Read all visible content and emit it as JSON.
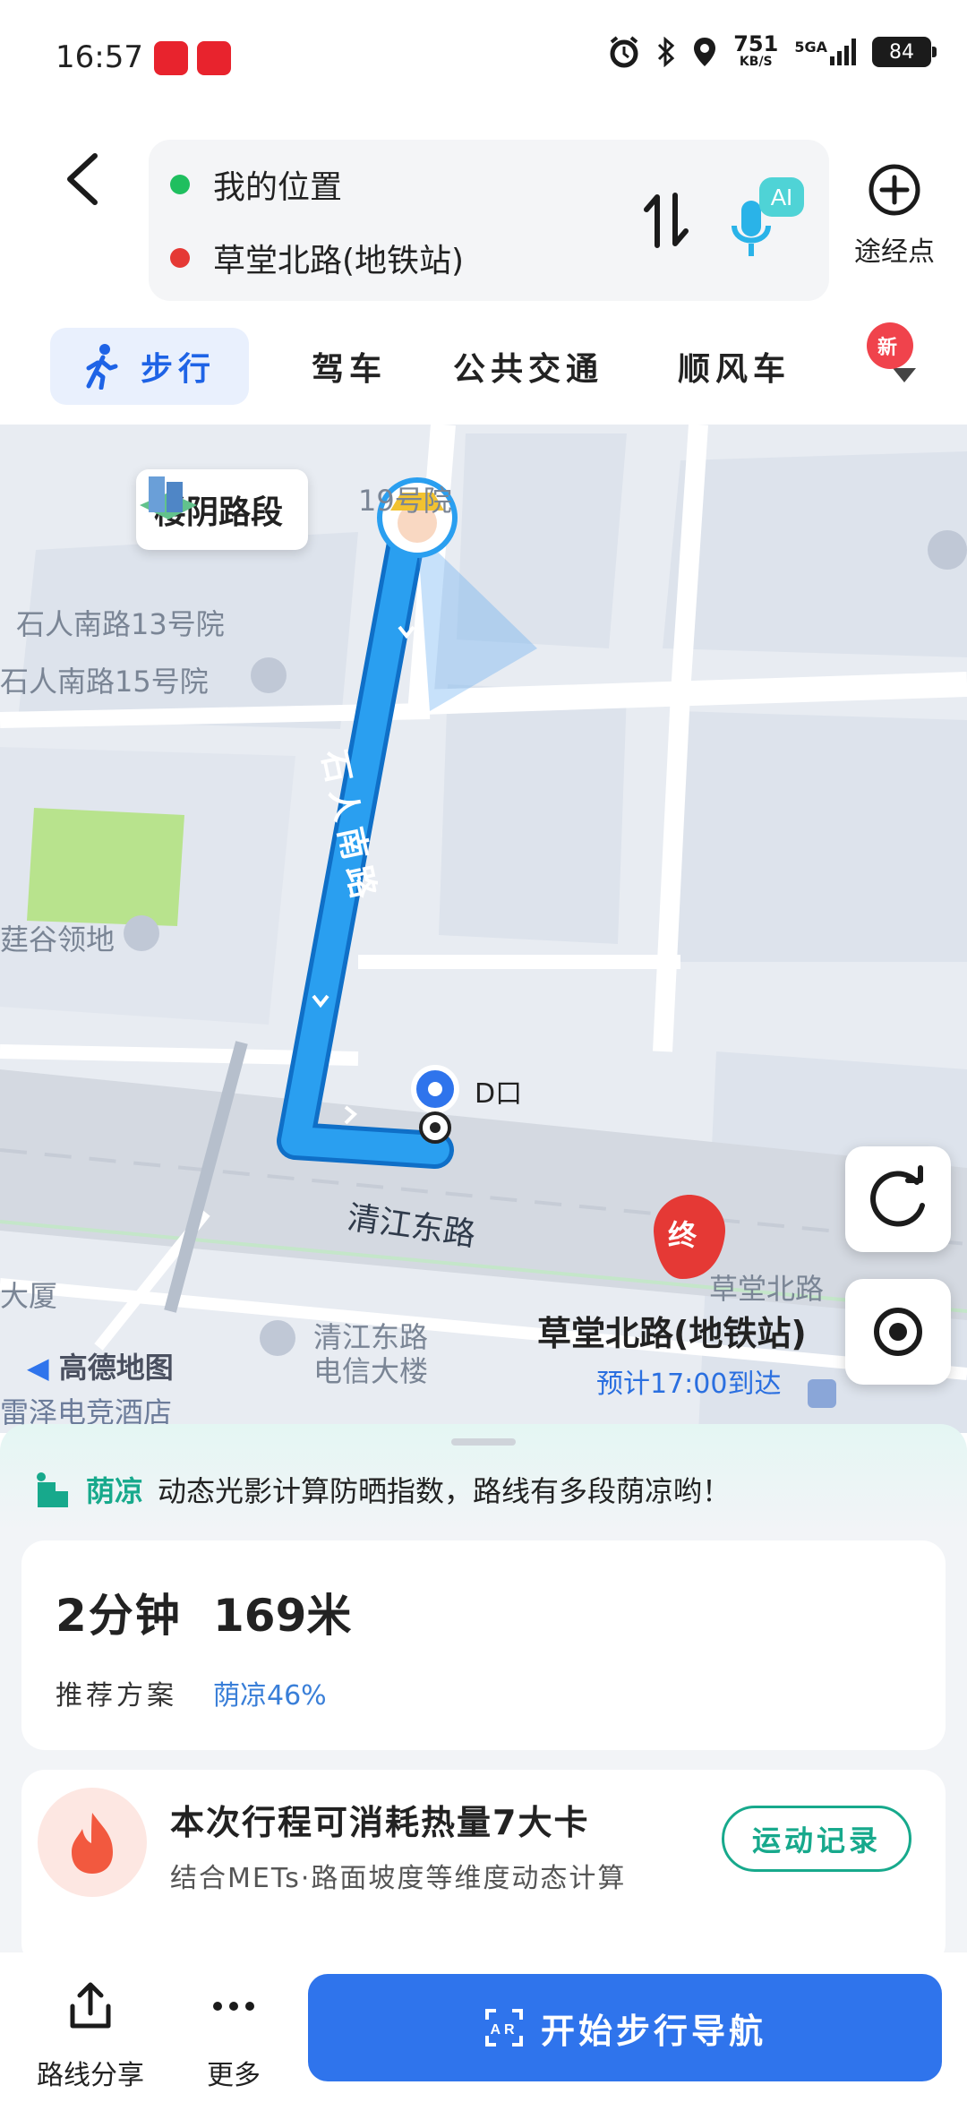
{
  "status_bar": {
    "time": "16:57",
    "speed_value": "751",
    "speed_unit": "KB/S",
    "network": "5GA",
    "battery": "84"
  },
  "route": {
    "origin": "我的位置",
    "destination": "草堂北路(地铁站)",
    "origin_color": "#1fbf5f",
    "destination_color": "#e53935",
    "ai_label": "AI",
    "waypoint_label": "途经点"
  },
  "tabs": [
    {
      "label": "步行",
      "active": true
    },
    {
      "label": "驾车",
      "active": false
    },
    {
      "label": "公共交通",
      "active": false
    },
    {
      "label": "顺风车",
      "active": false
    }
  ],
  "new_badge": "新",
  "map": {
    "segment_chip": "楼阴路段",
    "labels": {
      "yard19": "19号院",
      "shiren13": "石人南路13号院",
      "shiren15": "石人南路15号院",
      "lingdi": "莛谷领地",
      "street_vertical": "石人南路",
      "exit_d": "D口",
      "qingjiang": "清江东路",
      "dasha": "大厦",
      "telecom": "清江东路\n电信大楼",
      "hotel": "雷泽电竞酒店",
      "caotang_small": "草堂北路"
    },
    "brand": "高德地图",
    "dest_marker": "终",
    "dest_title": "草堂北路(地铁站)",
    "eta": "预计17:00到达",
    "route_color": "#2a9ff0"
  },
  "sheet": {
    "shade_tag": "荫凉",
    "shade_text": "动态光影计算防晒指数，路线有多段荫凉哟！",
    "route_time": "2分钟",
    "route_distance": "169米",
    "route_recommend": "推荐方案",
    "route_shade": "荫凉46%",
    "calorie_title": "本次行程可消耗热量7大卡",
    "calorie_sub": "结合METs·路面坡度等维度动态计算",
    "record_button": "运动记录"
  },
  "bottom_bar": {
    "share": "路线分享",
    "more": "更多",
    "start": "开始步行导航"
  }
}
